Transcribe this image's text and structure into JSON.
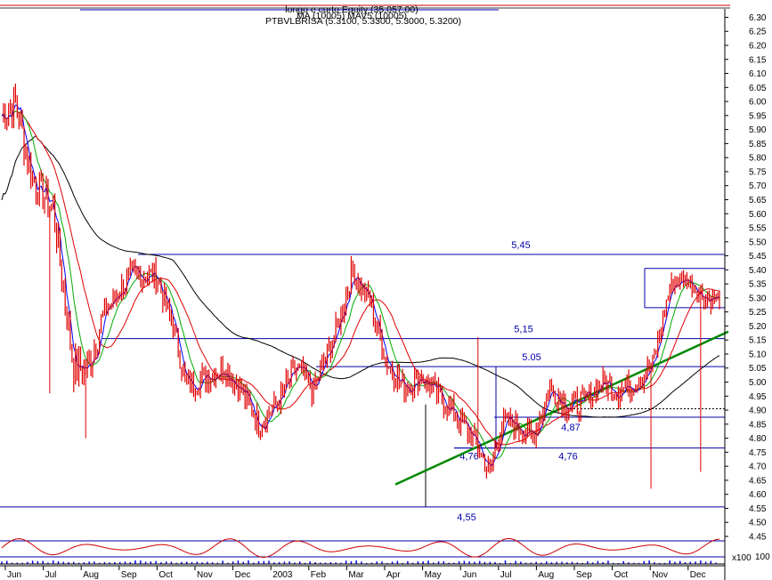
{
  "chart_data": {
    "type": "candlestick",
    "header_lines": [
      "longo e curto Equity (35,057.00)",
      "MA (10005) MAV5 (10005)",
      "PTBVLBRISA (5.3100, 5.3300, 5.3000, 5.3200)"
    ],
    "ylim": [
      4.45,
      6.33
    ],
    "y_ticks": [
      "4.45",
      "4.50",
      "4.55",
      "4.60",
      "4.65",
      "4.70",
      "4.75",
      "4.80",
      "4.85",
      "4.90",
      "4.95",
      "5.00",
      "5.05",
      "5.10",
      "5.15",
      "5.20",
      "5.25",
      "5.30",
      "5.35",
      "5.40",
      "5.45",
      "5.50",
      "5.55",
      "5.60",
      "5.65",
      "5.70",
      "5.75",
      "5.80",
      "5.85",
      "5.90",
      "5.95",
      "6.00",
      "6.05",
      "6.10",
      "6.15",
      "6.20",
      "6.25",
      "6.30"
    ],
    "x_labels": [
      "Jun",
      "Jul",
      "Aug",
      "Sep",
      "Oct",
      "Nov",
      "Dec",
      "2003",
      "Feb",
      "Mar",
      "Apr",
      "May",
      "Jun",
      "Jul",
      "Aug",
      "Sep",
      "Oct",
      "Nov",
      "Dec"
    ],
    "price_anchors": [
      [
        0,
        5.95
      ],
      [
        8,
        6.0
      ],
      [
        18,
        5.72
      ],
      [
        30,
        5.62
      ],
      [
        42,
        5.05
      ],
      [
        50,
        5.05
      ],
      [
        60,
        5.25
      ],
      [
        75,
        5.38
      ],
      [
        90,
        5.38
      ],
      [
        100,
        5.2
      ],
      [
        108,
        4.98
      ],
      [
        118,
        5.02
      ],
      [
        130,
        5.05
      ],
      [
        140,
        4.97
      ],
      [
        150,
        4.85
      ],
      [
        160,
        4.92
      ],
      [
        172,
        5.05
      ],
      [
        182,
        4.97
      ],
      [
        195,
        5.18
      ],
      [
        205,
        5.4
      ],
      [
        215,
        5.28
      ],
      [
        225,
        5.07
      ],
      [
        235,
        4.98
      ],
      [
        245,
        5.02
      ],
      [
        255,
        4.95
      ],
      [
        265,
        4.88
      ],
      [
        275,
        4.8
      ],
      [
        285,
        4.68
      ],
      [
        292,
        4.85
      ],
      [
        300,
        4.85
      ],
      [
        310,
        4.8
      ],
      [
        320,
        4.98
      ],
      [
        330,
        4.92
      ],
      [
        340,
        4.93
      ],
      [
        350,
        5.0
      ],
      [
        360,
        4.97
      ],
      [
        370,
        5.0
      ],
      [
        380,
        5.06
      ],
      [
        390,
        5.34
      ],
      [
        400,
        5.37
      ],
      [
        410,
        5.3
      ],
      [
        418,
        5.3
      ]
    ],
    "levels": [
      {
        "label": "5,45",
        "value": 5.455
      },
      {
        "label": "5,15",
        "value": 5.155
      },
      {
        "label": "5.05",
        "value": 5.055
      },
      {
        "label": "4,87",
        "value": 4.875
      },
      {
        "label": "4,76",
        "value": 4.765
      },
      {
        "label": "4,76",
        "value": 4.765
      },
      {
        "label": "4,55",
        "value": 4.555
      }
    ],
    "dotted_level": 4.905,
    "trendline": {
      "from": [
        4.635
      ],
      "to": [
        5.18
      ]
    },
    "indicator_label": "x100",
    "indicator_tick": "100",
    "colors": {
      "price": "#e00000",
      "ma_fast": "#0000ff",
      "ma_mid": "#00aa00",
      "ma_slow": "#e00000",
      "ma_long": "#000000",
      "levels": "#0000aa",
      "trend": "#008800"
    }
  }
}
